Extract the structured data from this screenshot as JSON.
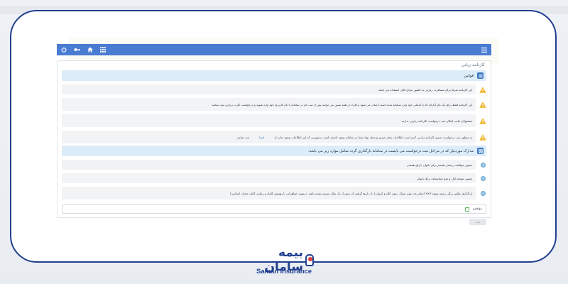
{
  "panel": {
    "title": "کارنامه زیانی"
  },
  "rules_section": {
    "title": "قوانین",
    "items": [
      {
        "text": "این کارنامه صرفا برای مسافرت زیارتی به کشور عراق قابل استفاده می باشد."
      },
      {
        "text": "این کارنامه فقط برای یک نام (دارای که با کدملی خود وارد سامانه شده است) صادر می شود و افراد در همه سنین می توانند پس از ثبت نام در سامانه با نام کاربری خود وارد شوند و درخواست کارت زیارتی ثبت نمایند."
      },
      {
        "text": "مشمولان غایب امکان ثبت درخواست کارنامه زیارتی ندارند."
      },
      {
        "text": "به منظور ثبت درخواست صدور کارنامه زیارتی لازم است اطلاعات محل صدور و محل تولد شما در سامانه وجود داشته باشد، درصورتی که این اطلاعات وجود ندارد از",
        "link": "اینجا",
        "suffix": "ثبت نمایید."
      }
    ]
  },
  "docs_section": {
    "title": "مدارک موردنیاز که در مراحل ثبت درخواست می بایست در سامانه بارگذاری گردد شامل موارد زیر می باشد:",
    "items": [
      {
        "text": "تصویر موافقت رسمی همسر برای بانوان دارای همسر"
      },
      {
        "text": "تصویر صفحه اول و دوم شناسنامه برای بانوان"
      },
      {
        "text": "بارگذاری عکس رنگی زمینه سفید ۳×۴ (تمام رخ، بدون عینک، بدون کلاه و کروات)، از تاریخ گرفتن آن بیش از یک سال سپری نشده باشد. درمورد خواهرانی با پوشش کامل و رعایت کامل حجاب اسلامی)"
      }
    ]
  },
  "agree": {
    "label": "موافقم"
  },
  "submit": {
    "label": "ثبت"
  },
  "brand": {
    "name_fa": "بیمه سامان",
    "name_en": "Saman Insurance"
  },
  "colors": {
    "frame": "#213f8f",
    "topbar": "#4a7bd2",
    "section_bg": "#dcecf8",
    "warning": "#f0b429",
    "logo_red": "#e03a3a"
  }
}
